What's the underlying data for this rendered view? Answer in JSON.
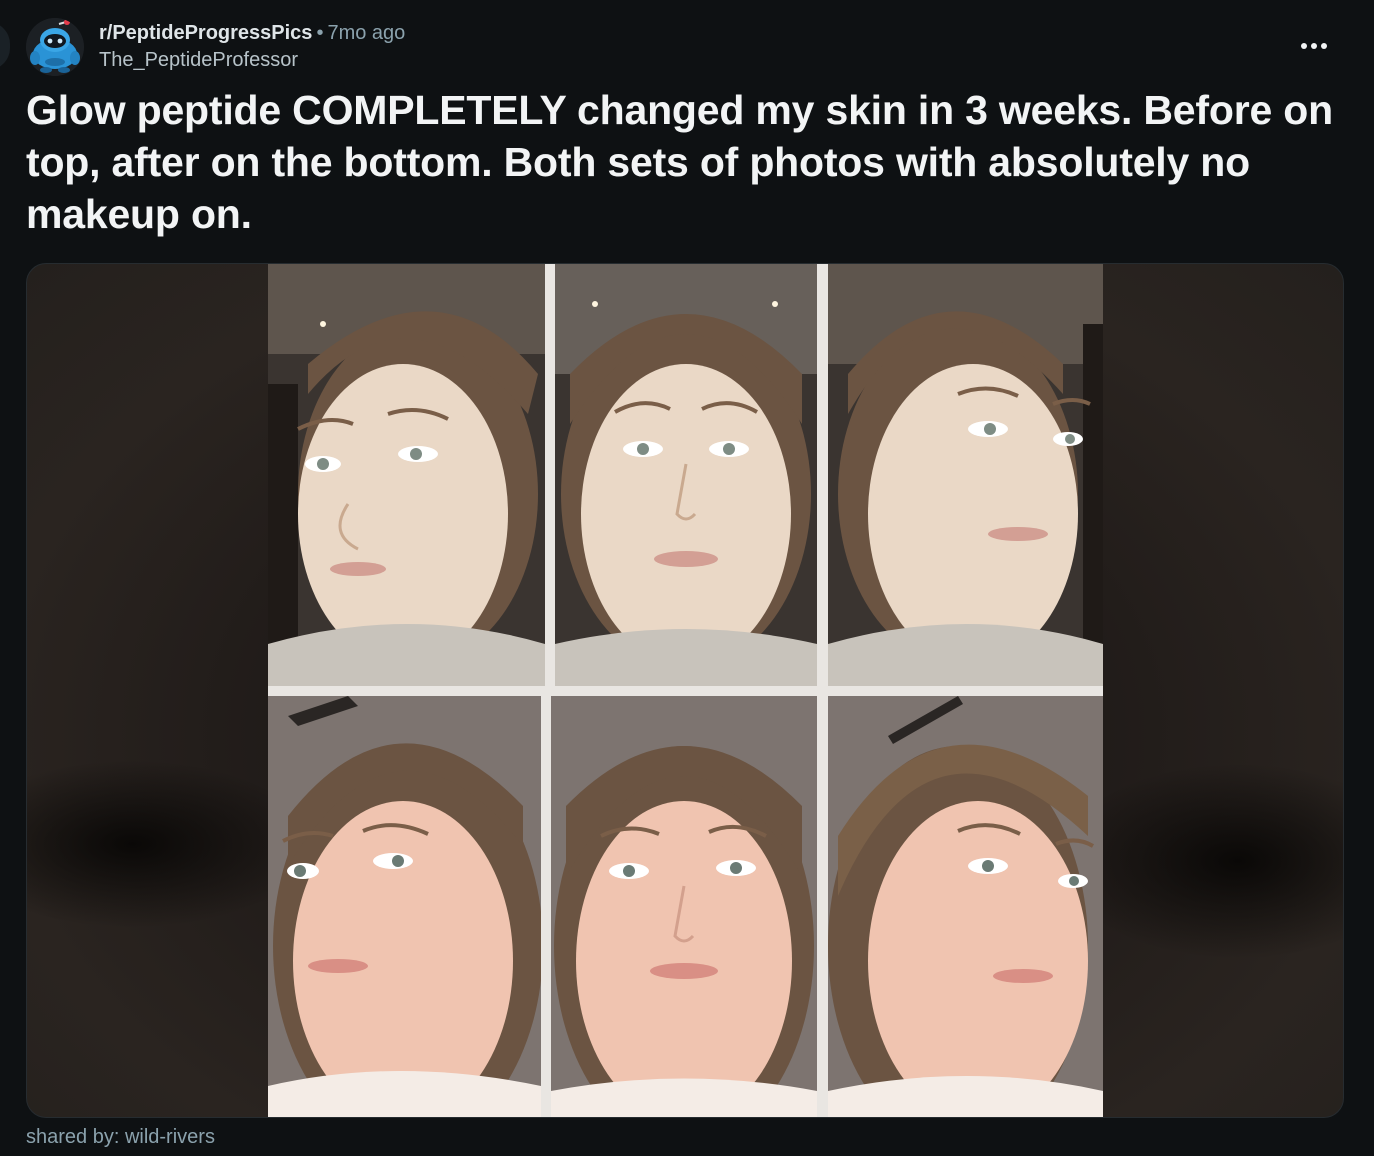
{
  "post": {
    "subreddit": "r/PeptideProgressPics",
    "separator": "•",
    "age": "7mo ago",
    "author": "The_PeptideProfessor",
    "title": "Glow peptide COMPLETELY changed my skin in 3 weeks. Before on top, after on the bottom. Both sets of photos with absolutely no makeup on.",
    "more_icon": "more-options-icon",
    "avatar_icon": "robot-mascot-icon"
  },
  "media": {
    "rows": [
      {
        "label": "before",
        "poses": [
          "three-quarter-left",
          "front",
          "three-quarter-right"
        ]
      },
      {
        "label": "after",
        "poses": [
          "three-quarter-left",
          "front",
          "three-quarter-right"
        ]
      }
    ],
    "colors": {
      "before_skin": "#ead8c6",
      "after_skin": "#f0c4b0",
      "hair": "#6b5442",
      "before_bg": "#3a3430",
      "after_bg": "#7d7470"
    }
  },
  "footer": {
    "caption": "shared by: wild-rivers"
  }
}
